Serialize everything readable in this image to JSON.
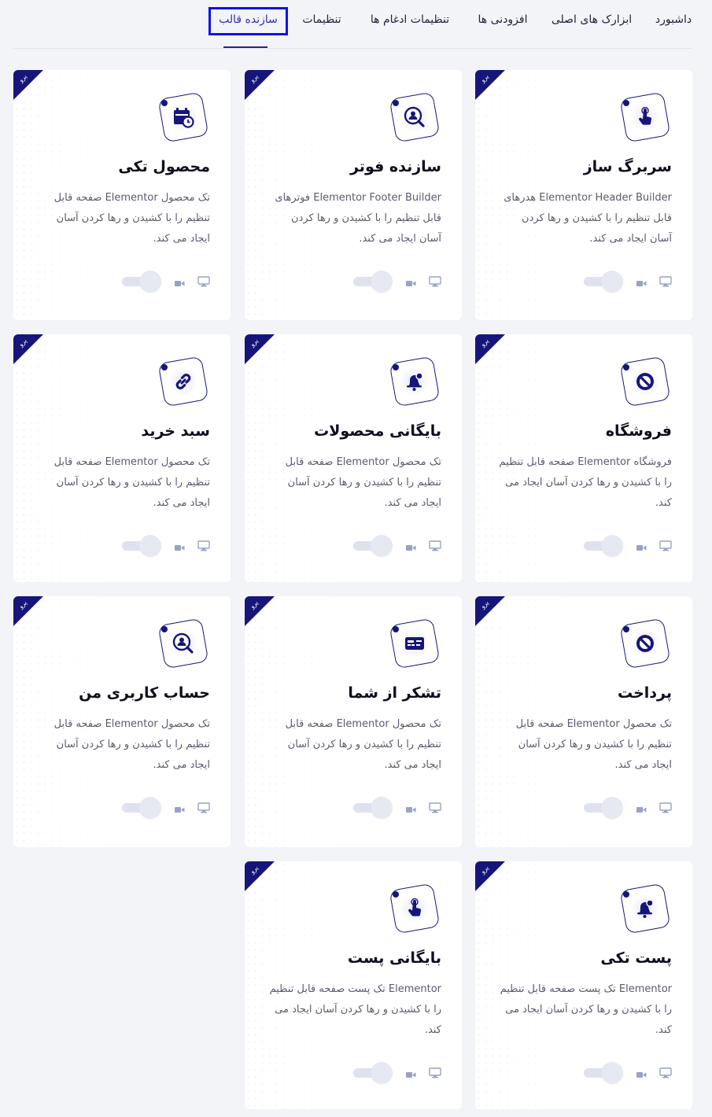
{
  "nav": {
    "tabs": [
      {
        "label": "داشبورد"
      },
      {
        "label": "ابزارک های اصلی"
      },
      {
        "label": "افزودنی ها"
      },
      {
        "label": "تنظیمات ادغام ها"
      },
      {
        "label": "تنظیمات"
      },
      {
        "label": "سازنده قالب"
      }
    ],
    "active_tab": "سازنده قالب"
  },
  "badge_label": "پرو",
  "cards": [
    {
      "title": "سربرگ ساز",
      "desc": "Elementor Header Builder هدرهای قابل تنظیم را با کشیدن و رها کردن آسان ایجاد می کند.",
      "icon": "pointer-hand-icon",
      "toggle_on": false
    },
    {
      "title": "سازنده فوتر",
      "desc": "Elementor Footer Builder فوترهای قابل تنظیم را با کشیدن و رها کردن آسان ایجاد می کند.",
      "icon": "search-user-icon",
      "toggle_on": false
    },
    {
      "title": "محصول تکی",
      "desc": "تک محصول Elementor صفحه قابل تنظیم را با کشیدن و رها کردن آسان ایجاد می کند.",
      "icon": "calendar-clock-icon",
      "toggle_on": false
    },
    {
      "title": "فروشگاه",
      "desc": "فروشگاه Elementor صفحه قابل تنظیم را با کشیدن و رها کردن آسان ایجاد می کند.",
      "icon": "ban-icon",
      "toggle_on": false
    },
    {
      "title": "بایگانی محصولات",
      "desc": "تک محصول Elementor صفحه قابل تنظیم را با کشیدن و رها کردن آسان ایجاد می کند.",
      "icon": "bell-user-icon",
      "toggle_on": false
    },
    {
      "title": "سبد خرید",
      "desc": "تک محصول Elementor صفحه قابل تنظیم را با کشیدن و رها کردن آسان ایجاد می کند.",
      "icon": "link-icon",
      "toggle_on": false
    },
    {
      "title": "پرداخت",
      "desc": "تک محصول Elementor صفحه قابل تنظیم را با کشیدن و رها کردن آسان ایجاد می کند.",
      "icon": "ban-icon",
      "toggle_on": false
    },
    {
      "title": "تشکر از شما",
      "desc": "تک محصول Elementor صفحه قابل تنظیم را با کشیدن و رها کردن آسان ایجاد می کند.",
      "icon": "id-card-icon",
      "toggle_on": false
    },
    {
      "title": "حساب کاربری من",
      "desc": "تک محصول Elementor صفحه قابل تنظیم را با کشیدن و رها کردن آسان ایجاد می کند.",
      "icon": "search-user-icon",
      "toggle_on": false
    },
    {
      "title": "پست تکی",
      "desc": "Elementor تک پست صفحه قابل تنظیم را با کشیدن و رها کردن آسان ایجاد می کند.",
      "icon": "bell-user-icon",
      "toggle_on": false
    },
    {
      "title": "بایگانی پست",
      "desc": "Elementor تک پست صفحه قابل تنظیم را با کشیدن و رها کردن آسان ایجاد می کند.",
      "icon": "pointer-hand-icon",
      "toggle_on": false
    }
  ],
  "colors": {
    "accent": "#16167a",
    "tab_active": "#2f2fb0",
    "highlight_frame": "#1010ee",
    "background": "#f3f4f8"
  }
}
